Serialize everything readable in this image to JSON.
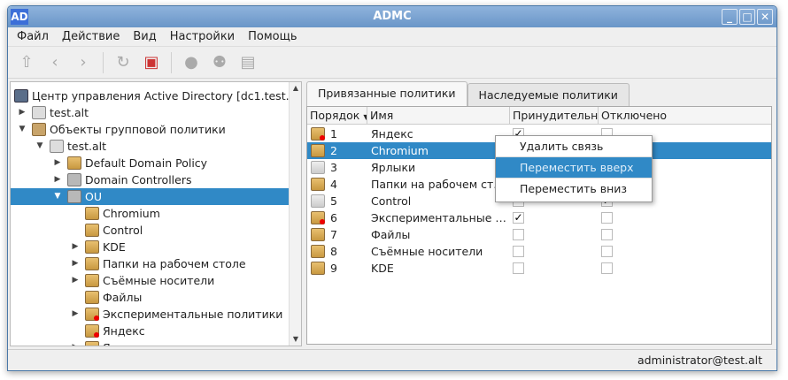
{
  "window": {
    "title": "ADMC",
    "logo": "AD",
    "buttons": [
      "minimize",
      "maximize",
      "close"
    ]
  },
  "menu": [
    "Файл",
    "Действие",
    "Вид",
    "Настройки",
    "Помощь"
  ],
  "toolbar": [
    "navigate-up-icon",
    "back-icon",
    "forward-icon",
    "refresh-icon",
    "properties-icon",
    "create-user-icon",
    "create-group-icon",
    "create-ou-icon"
  ],
  "tree": [
    {
      "label": "Центр управления Active Directory [dc1.test.alt]",
      "level": 0,
      "arrow": "",
      "icon": "comp"
    },
    {
      "label": "test.alt",
      "level": 1,
      "arrow": "right",
      "icon": "srv"
    },
    {
      "label": "Объекты групповой политики",
      "level": 1,
      "arrow": "down",
      "icon": "folder"
    },
    {
      "label": "test.alt",
      "level": 2,
      "arrow": "down",
      "icon": "srv"
    },
    {
      "label": "Default Domain Policy",
      "level": 3,
      "arrow": "right",
      "icon": "gpo"
    },
    {
      "label": "Domain Controllers",
      "level": 3,
      "arrow": "right",
      "icon": "ou"
    },
    {
      "label": "OU",
      "level": 3,
      "arrow": "down",
      "icon": "ou",
      "selected": true
    },
    {
      "label": "Chromium",
      "level": 4,
      "arrow": "",
      "icon": "gpo"
    },
    {
      "label": "Control",
      "level": 4,
      "arrow": "",
      "icon": "gpo"
    },
    {
      "label": "KDE",
      "level": 4,
      "arrow": "right",
      "icon": "gpo"
    },
    {
      "label": "Папки на рабочем столе",
      "level": 4,
      "arrow": "right",
      "icon": "gpo"
    },
    {
      "label": "Съёмные носители",
      "level": 4,
      "arrow": "right",
      "icon": "gpo"
    },
    {
      "label": "Файлы",
      "level": 4,
      "arrow": "",
      "icon": "gpo"
    },
    {
      "label": "Экспериментальные политики",
      "level": 4,
      "arrow": "right",
      "icon": "gpo red"
    },
    {
      "label": "Яндекс",
      "level": 4,
      "arrow": "",
      "icon": "gpo red"
    },
    {
      "label": "Ярлыки",
      "level": 4,
      "arrow": "right",
      "icon": "gpo"
    }
  ],
  "tabs": [
    "Привязанные политики",
    "Наследуемые политики"
  ],
  "columns": [
    "Порядок",
    "Имя",
    "Принудительно",
    "Отключено"
  ],
  "rows": [
    {
      "order": "1",
      "name": "Яндекс",
      "enforced": true,
      "disabled": false,
      "icon": "gpo red"
    },
    {
      "order": "2",
      "name": "Chromium",
      "enforced": false,
      "disabled": false,
      "icon": "gpo",
      "selected": true
    },
    {
      "order": "3",
      "name": "Ярлыки",
      "enforced": false,
      "disabled": false,
      "icon": "gpo grey"
    },
    {
      "order": "4",
      "name": "Папки на рабочем столе",
      "enforced": false,
      "disabled": false,
      "icon": "gpo"
    },
    {
      "order": "5",
      "name": "Control",
      "enforced": false,
      "disabled": true,
      "icon": "gpo grey"
    },
    {
      "order": "6",
      "name": "Экспериментальные политики",
      "enforced": true,
      "disabled": false,
      "icon": "gpo red"
    },
    {
      "order": "7",
      "name": "Файлы",
      "enforced": false,
      "disabled": false,
      "icon": "gpo"
    },
    {
      "order": "8",
      "name": "Съёмные носители",
      "enforced": false,
      "disabled": false,
      "icon": "gpo"
    },
    {
      "order": "9",
      "name": "KDE",
      "enforced": false,
      "disabled": false,
      "icon": "gpo"
    }
  ],
  "context_menu": [
    {
      "label": "Удалить связь"
    },
    {
      "label": "Переместить вверх",
      "highlighted": true
    },
    {
      "label": "Переместить вниз"
    }
  ],
  "status": "administrator@test.alt",
  "colors": {
    "selection": "#3089c6",
    "titlebar": "#7aa3d2"
  }
}
